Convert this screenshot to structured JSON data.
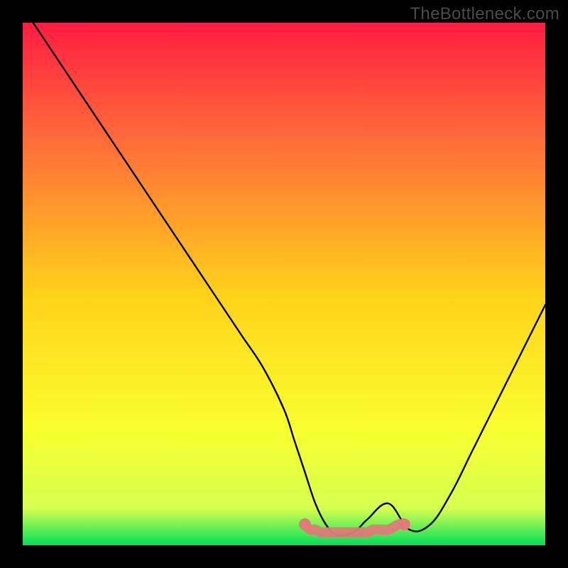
{
  "watermark": "TheBottleneck.com",
  "chart_data": {
    "type": "line",
    "title": "",
    "xlabel": "",
    "ylabel": "",
    "xlim": [
      0,
      100
    ],
    "ylim": [
      0,
      100
    ],
    "gradient_bg": {
      "top": "#ff1c42",
      "upper_mid": "#ff6a3a",
      "mid": "#ffd21a",
      "lower_mid": "#f9ff2e",
      "near_bottom": "#d6ff50",
      "bottom": "#00e05a"
    },
    "series": [
      {
        "name": "black-curve",
        "color": "#000000",
        "x": [
          2,
          6,
          10,
          14,
          18,
          22,
          26,
          30,
          34,
          38,
          42,
          46,
          50,
          52,
          54,
          56,
          58,
          60,
          62,
          64,
          66,
          70,
          74,
          78,
          82,
          86,
          90,
          94,
          98,
          100
        ],
        "y": [
          100,
          94,
          88,
          82,
          76,
          70,
          64,
          58,
          52,
          46,
          40,
          34,
          26,
          20,
          14,
          8,
          4,
          2,
          2,
          3,
          5,
          8,
          3,
          4,
          10,
          18,
          26,
          34,
          42,
          46
        ]
      },
      {
        "name": "pink-marker-band",
        "color": "#e07a7a",
        "x": [
          54,
          55,
          56,
          57,
          58,
          59,
          60,
          61,
          62,
          63,
          64,
          65,
          66,
          67,
          68,
          69,
          70,
          71,
          72,
          73
        ],
        "y": [
          4,
          3,
          3,
          2.5,
          2.5,
          2.5,
          2.5,
          2.5,
          2.5,
          2.5,
          2.5,
          2.5,
          2.5,
          3,
          3,
          3,
          3,
          3.5,
          4,
          4
        ]
      }
    ]
  }
}
